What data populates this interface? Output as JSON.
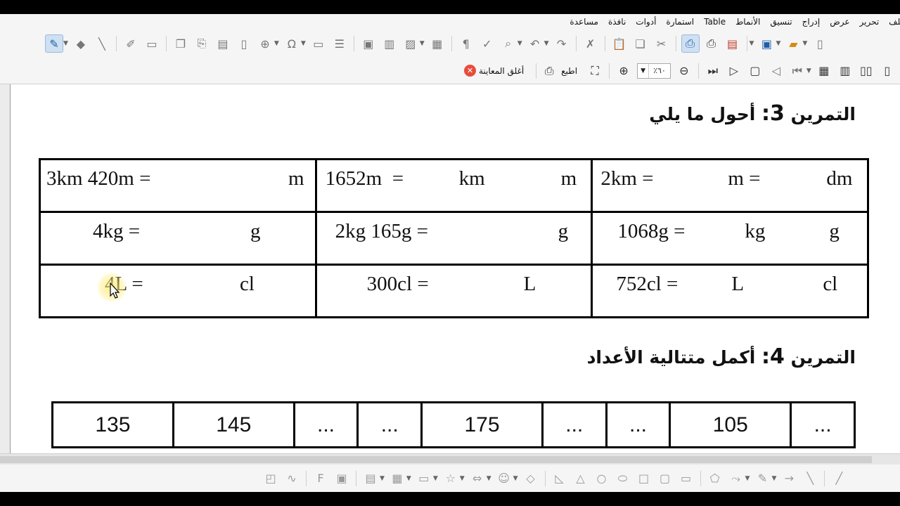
{
  "menu": [
    "ملف",
    "تحرير",
    "عرض",
    "إدراج",
    "تنسيق",
    "الأنماط",
    "Table",
    "استمارة",
    "أدوات",
    "نافذة",
    "مساعدة"
  ],
  "toolbar2": {
    "close_label": "أغلق المعاينة",
    "print_label": "اطبع",
    "zoom_value": "٪٦٠"
  },
  "exercise3": {
    "title_prefix": "التمرين",
    "number": "3:",
    "title_text": "أحول ما يلي"
  },
  "conversion_table": [
    [
      {
        "parts": [
          "3km 420m =",
          "m"
        ]
      },
      {
        "parts": [
          "1652m  =",
          "km",
          "m"
        ]
      },
      {
        "parts": [
          "2km =",
          "m =",
          "dm"
        ]
      }
    ],
    [
      {
        "parts": [
          "4kg =",
          "g"
        ]
      },
      {
        "parts": [
          "2kg 165g =",
          "g"
        ]
      },
      {
        "parts": [
          "1068g =",
          "kg",
          "g"
        ]
      }
    ],
    [
      {
        "parts": [
          "4L =",
          "cl"
        ]
      },
      {
        "parts": [
          "300cl =",
          "L"
        ]
      },
      {
        "parts": [
          "752cl =",
          "L",
          "cl"
        ]
      }
    ]
  ],
  "exercise4": {
    "title_prefix": "التمرين",
    "number": "4:",
    "title_text": "أكمل متتالية الأعداد"
  },
  "sequence": [
    "135",
    "145",
    "...",
    "...",
    "175",
    "...",
    "...",
    "105",
    "..."
  ]
}
